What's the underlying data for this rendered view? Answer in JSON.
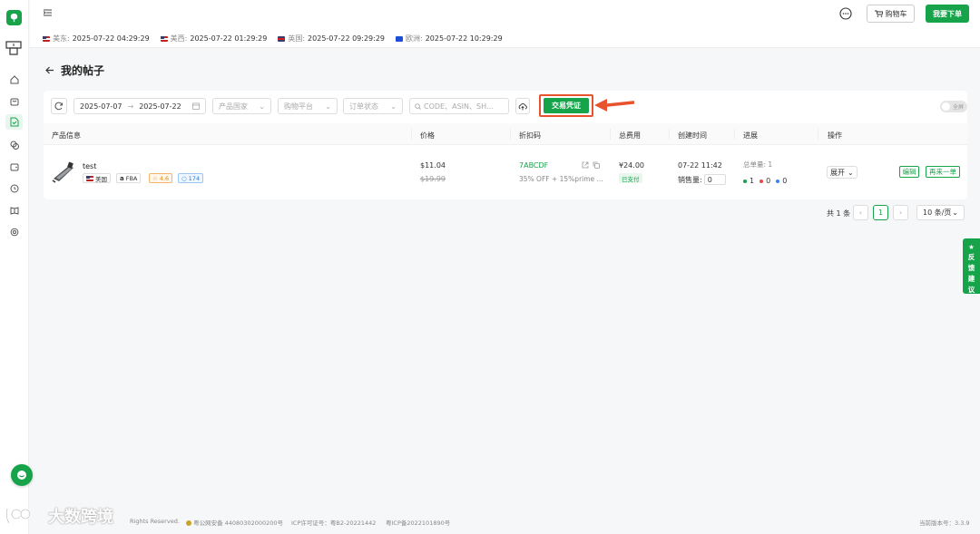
{
  "header": {
    "cart_label": "购物车",
    "order_label": "我要下单",
    "clocks": [
      {
        "flag": "us",
        "region": "美东:",
        "time": "2025-07-22 04:29:29"
      },
      {
        "flag": "us",
        "region": "美西:",
        "time": "2025-07-22 01:29:29"
      },
      {
        "flag": "uk",
        "region": "英国:",
        "time": "2025-07-22 09:29:29"
      },
      {
        "flag": "eu",
        "region": "欧洲:",
        "time": "2025-07-22 10:29:29"
      }
    ]
  },
  "page": {
    "title": "我的帖子"
  },
  "filters": {
    "date_start": "2025-07-07",
    "date_end": "2025-07-22",
    "country_placeholder": "产品国家",
    "platform_placeholder": "购物平台",
    "status_placeholder": "订单状态",
    "search_placeholder": "CODE、ASIN、SH...",
    "voucher_label": "交易凭证",
    "toggle_label": "全屏"
  },
  "table": {
    "headers": [
      "产品信息",
      "价格",
      "折扣码",
      "总费用",
      "创建时间",
      "进展",
      "操作"
    ],
    "rows": [
      {
        "name": "test",
        "country": "美国",
        "fulfillment": "FBA",
        "rating": "4.6",
        "reviews": "174",
        "price": "$11.04",
        "price_old": "$19.99",
        "code": "7ABCDF",
        "discount": "35% OFF + 15%prime ...",
        "fee": "¥24.00",
        "pay_status": "已支付",
        "created": "07-22 11:42",
        "sales_label": "销售量:",
        "sales_value": "0",
        "total_orders": "总单量: 1",
        "progress": {
          "green": "1",
          "red": "0",
          "blue": "0"
        },
        "expand_label": "展开",
        "edit_label": "编辑",
        "reorder_label": "再来一单"
      }
    ]
  },
  "pagination": {
    "total": "共 1 条",
    "current": "1",
    "page_size": "10 条/页"
  },
  "feedback": {
    "chars": [
      "反",
      "馈",
      "建",
      "议"
    ]
  },
  "footer": {
    "rights": "Rights Reserved.",
    "police": "粤公网安备 44080302000200号",
    "icp": "ICP许可证号：粤B2-20221442",
    "icp2": "粤ICP备2022101890号",
    "version": "当前版本号：3.3.9"
  },
  "watermark": {
    "text": "大数跨境"
  },
  "colors": {
    "brand": "#16a34a",
    "annotation": "#e8532d"
  }
}
